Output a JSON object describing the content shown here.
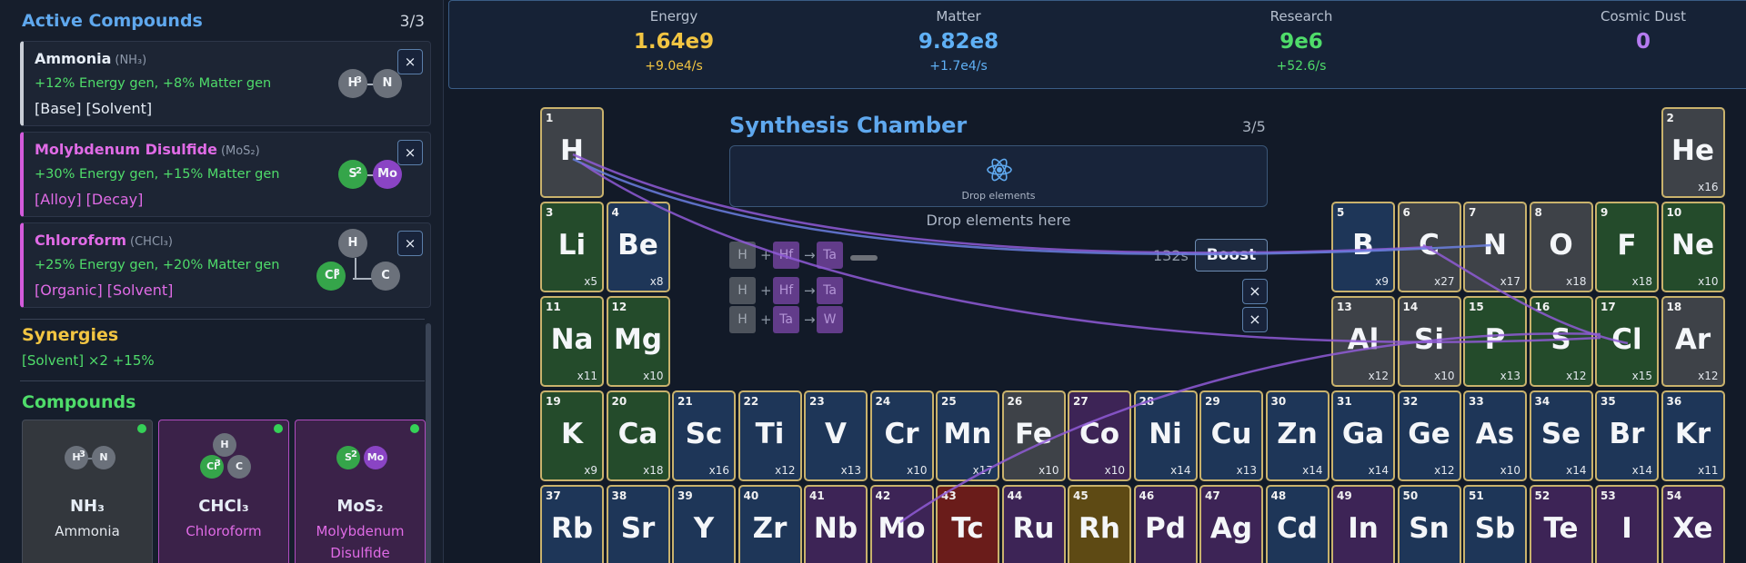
{
  "active": {
    "title": "Active Compounds",
    "count": "3/3",
    "items": [
      {
        "name": "Ammonia",
        "formula": "(NH₃)",
        "bonus": "+12% Energy gen, +8% Matter gen",
        "tags": "[Base] [Solvent]",
        "accent": "#c9ced6"
      },
      {
        "name": "Molybdenum Disulfide",
        "formula": "(MoS₂)",
        "bonus": "+30% Energy gen, +15% Matter gen",
        "tags": "[Alloy] [Decay]",
        "accent": "#d35bdb"
      },
      {
        "name": "Chloroform",
        "formula": "(CHCl₃)",
        "bonus": "+25% Energy gen, +20% Matter gen",
        "tags": "[Organic] [Solvent]",
        "accent": "#d35bdb"
      }
    ],
    "atoms": {
      "a1": {
        "a": "H",
        "b": "N",
        "sub": "3"
      },
      "a2": {
        "a": "S",
        "b": "Mo",
        "sub": "2"
      },
      "a3": {
        "top": "H",
        "a": "Cl",
        "b": "C",
        "sub": "3"
      }
    },
    "close": "×"
  },
  "synergies": {
    "title": "Synergies",
    "text": "[Solvent] ×2 +15%"
  },
  "compounds": {
    "title": "Compounds",
    "items": [
      {
        "formula": "NH₃",
        "name": "Ammonia",
        "atoms": [
          "H",
          "N"
        ],
        "sub": "3"
      },
      {
        "formula": "CHCl₃",
        "name": "Chloroform",
        "atoms": [
          "H",
          "Cl",
          "C"
        ],
        "sub": "3"
      },
      {
        "formula": "MoS₂",
        "name": "Molybdenum Disulfide",
        "atoms": [
          "S",
          "Mo"
        ],
        "sub": "2"
      }
    ]
  },
  "resources": [
    {
      "label": "Energy",
      "value": "1.64e9",
      "rate": "+9.0e4/s",
      "color": "#f2c542"
    },
    {
      "label": "Matter",
      "value": "9.82e8",
      "rate": "+1.7e4/s",
      "color": "#5fb0f5"
    },
    {
      "label": "Research",
      "value": "9e6",
      "rate": "+52.6/s",
      "color": "#4fdc6a"
    },
    {
      "label": "Cosmic Dust",
      "value": "0",
      "rate": "",
      "color": "#b57bf0"
    }
  ],
  "synthesis": {
    "title": "Synthesis Chamber",
    "count": "3/5",
    "drop_small": "Drop elements",
    "drop_hint": "Drop elements here",
    "timer": "132s",
    "boost": "Boost",
    "close": "×",
    "reactions": [
      {
        "a": "H",
        "b": "Hf",
        "c": "Ta",
        "op1": "+",
        "op2": "→"
      },
      {
        "a": "H",
        "b": "Hf",
        "c": "Ta",
        "op1": "+",
        "op2": "→"
      },
      {
        "a": "H",
        "b": "Ta",
        "c": "W",
        "op1": "+",
        "op2": "→"
      }
    ]
  },
  "elements": [
    {
      "n": "1",
      "s": "H",
      "c": "",
      "col": 0,
      "row": 0,
      "cls": "c-grey"
    },
    {
      "n": "2",
      "s": "He",
      "c": "x16",
      "col": 17,
      "row": 0,
      "cls": "c-grey"
    },
    {
      "n": "3",
      "s": "Li",
      "c": "x5",
      "col": 0,
      "row": 1,
      "cls": "c-green"
    },
    {
      "n": "4",
      "s": "Be",
      "c": "x8",
      "col": 1,
      "row": 1,
      "cls": "c-blue"
    },
    {
      "n": "5",
      "s": "B",
      "c": "x9",
      "col": 12,
      "row": 1,
      "cls": "c-blue"
    },
    {
      "n": "6",
      "s": "C",
      "c": "x27",
      "col": 13,
      "row": 1,
      "cls": "c-grey"
    },
    {
      "n": "7",
      "s": "N",
      "c": "x17",
      "col": 14,
      "row": 1,
      "cls": "c-grey"
    },
    {
      "n": "8",
      "s": "O",
      "c": "x18",
      "col": 15,
      "row": 1,
      "cls": "c-grey"
    },
    {
      "n": "9",
      "s": "F",
      "c": "x18",
      "col": 16,
      "row": 1,
      "cls": "c-green"
    },
    {
      "n": "10",
      "s": "Ne",
      "c": "x10",
      "col": 17,
      "row": 1,
      "cls": "c-green"
    },
    {
      "n": "11",
      "s": "Na",
      "c": "x11",
      "col": 0,
      "row": 2,
      "cls": "c-green"
    },
    {
      "n": "12",
      "s": "Mg",
      "c": "x10",
      "col": 1,
      "row": 2,
      "cls": "c-green"
    },
    {
      "n": "13",
      "s": "Al",
      "c": "x12",
      "col": 12,
      "row": 2,
      "cls": "c-grey"
    },
    {
      "n": "14",
      "s": "Si",
      "c": "x10",
      "col": 13,
      "row": 2,
      "cls": "c-grey"
    },
    {
      "n": "15",
      "s": "P",
      "c": "x13",
      "col": 14,
      "row": 2,
      "cls": "c-green"
    },
    {
      "n": "16",
      "s": "S",
      "c": "x12",
      "col": 15,
      "row": 2,
      "cls": "c-green"
    },
    {
      "n": "17",
      "s": "Cl",
      "c": "x15",
      "col": 16,
      "row": 2,
      "cls": "c-green"
    },
    {
      "n": "18",
      "s": "Ar",
      "c": "x12",
      "col": 17,
      "row": 2,
      "cls": "c-grey"
    },
    {
      "n": "19",
      "s": "K",
      "c": "x9",
      "col": 0,
      "row": 3,
      "cls": "c-green"
    },
    {
      "n": "20",
      "s": "Ca",
      "c": "x18",
      "col": 1,
      "row": 3,
      "cls": "c-green"
    },
    {
      "n": "21",
      "s": "Sc",
      "c": "x16",
      "col": 2,
      "row": 3,
      "cls": "c-blue"
    },
    {
      "n": "22",
      "s": "Ti",
      "c": "x12",
      "col": 3,
      "row": 3,
      "cls": "c-blue"
    },
    {
      "n": "23",
      "s": "V",
      "c": "x13",
      "col": 4,
      "row": 3,
      "cls": "c-blue"
    },
    {
      "n": "24",
      "s": "Cr",
      "c": "x10",
      "col": 5,
      "row": 3,
      "cls": "c-blue"
    },
    {
      "n": "25",
      "s": "Mn",
      "c": "x17",
      "col": 6,
      "row": 3,
      "cls": "c-blue"
    },
    {
      "n": "26",
      "s": "Fe",
      "c": "x10",
      "col": 7,
      "row": 3,
      "cls": "c-grey"
    },
    {
      "n": "27",
      "s": "Co",
      "c": "x10",
      "col": 8,
      "row": 3,
      "cls": "c-purple"
    },
    {
      "n": "28",
      "s": "Ni",
      "c": "x14",
      "col": 9,
      "row": 3,
      "cls": "c-blue"
    },
    {
      "n": "29",
      "s": "Cu",
      "c": "x13",
      "col": 10,
      "row": 3,
      "cls": "c-blue"
    },
    {
      "n": "30",
      "s": "Zn",
      "c": "x14",
      "col": 11,
      "row": 3,
      "cls": "c-blue"
    },
    {
      "n": "31",
      "s": "Ga",
      "c": "x14",
      "col": 12,
      "row": 3,
      "cls": "c-blue"
    },
    {
      "n": "32",
      "s": "Ge",
      "c": "x12",
      "col": 13,
      "row": 3,
      "cls": "c-blue"
    },
    {
      "n": "33",
      "s": "As",
      "c": "x10",
      "col": 14,
      "row": 3,
      "cls": "c-blue"
    },
    {
      "n": "34",
      "s": "Se",
      "c": "x14",
      "col": 15,
      "row": 3,
      "cls": "c-blue"
    },
    {
      "n": "35",
      "s": "Br",
      "c": "x14",
      "col": 16,
      "row": 3,
      "cls": "c-blue"
    },
    {
      "n": "36",
      "s": "Kr",
      "c": "x11",
      "col": 17,
      "row": 3,
      "cls": "c-blue"
    },
    {
      "n": "37",
      "s": "Rb",
      "c": "",
      "col": 0,
      "row": 4,
      "cls": "c-blue"
    },
    {
      "n": "38",
      "s": "Sr",
      "c": "",
      "col": 1,
      "row": 4,
      "cls": "c-blue"
    },
    {
      "n": "39",
      "s": "Y",
      "c": "",
      "col": 2,
      "row": 4,
      "cls": "c-blue"
    },
    {
      "n": "40",
      "s": "Zr",
      "c": "",
      "col": 3,
      "row": 4,
      "cls": "c-blue"
    },
    {
      "n": "41",
      "s": "Nb",
      "c": "",
      "col": 4,
      "row": 4,
      "cls": "c-purple"
    },
    {
      "n": "42",
      "s": "Mo",
      "c": "",
      "col": 5,
      "row": 4,
      "cls": "c-purple"
    },
    {
      "n": "43",
      "s": "Tc",
      "c": "",
      "col": 6,
      "row": 4,
      "cls": "c-red"
    },
    {
      "n": "44",
      "s": "Ru",
      "c": "",
      "col": 7,
      "row": 4,
      "cls": "c-purple"
    },
    {
      "n": "45",
      "s": "Rh",
      "c": "",
      "col": 8,
      "row": 4,
      "cls": "c-gold"
    },
    {
      "n": "46",
      "s": "Pd",
      "c": "",
      "col": 9,
      "row": 4,
      "cls": "c-purple"
    },
    {
      "n": "47",
      "s": "Ag",
      "c": "",
      "col": 10,
      "row": 4,
      "cls": "c-purple"
    },
    {
      "n": "48",
      "s": "Cd",
      "c": "",
      "col": 11,
      "row": 4,
      "cls": "c-blue"
    },
    {
      "n": "49",
      "s": "In",
      "c": "",
      "col": 12,
      "row": 4,
      "cls": "c-purple"
    },
    {
      "n": "50",
      "s": "Sn",
      "c": "",
      "col": 13,
      "row": 4,
      "cls": "c-blue"
    },
    {
      "n": "51",
      "s": "Sb",
      "c": "",
      "col": 14,
      "row": 4,
      "cls": "c-blue"
    },
    {
      "n": "52",
      "s": "Te",
      "c": "",
      "col": 15,
      "row": 4,
      "cls": "c-purple"
    },
    {
      "n": "53",
      "s": "I",
      "c": "",
      "col": 16,
      "row": 4,
      "cls": "c-purple"
    },
    {
      "n": "54",
      "s": "Xe",
      "c": "",
      "col": 17,
      "row": 4,
      "cls": "c-purple"
    }
  ]
}
